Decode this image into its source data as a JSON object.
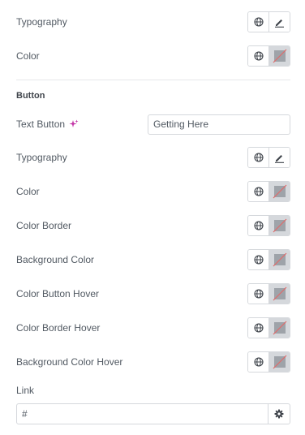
{
  "style_section": {
    "typography_label": "Typography",
    "color_label": "Color"
  },
  "button_section": {
    "title": "Button",
    "text_button_label": "Text Button",
    "text_button_value": "Getting Here",
    "typography_label": "Typography",
    "color_label": "Color",
    "color_border_label": "Color Border",
    "background_color_label": "Background Color",
    "color_button_hover_label": "Color Button Hover",
    "color_border_hover_label": "Color Border Hover",
    "background_color_hover_label": "Background Color Hover"
  },
  "link": {
    "label": "Link",
    "value": "#"
  },
  "icons": {
    "globe": "globe-icon",
    "edit": "pencil-icon",
    "swatch": "empty-color-swatch-icon",
    "ai": "sparkle-icon",
    "settings": "gear-icon"
  },
  "colors": {
    "swatch_slash": "#e06b6b",
    "ai_accent": "#c335a6",
    "text": "#515962"
  }
}
